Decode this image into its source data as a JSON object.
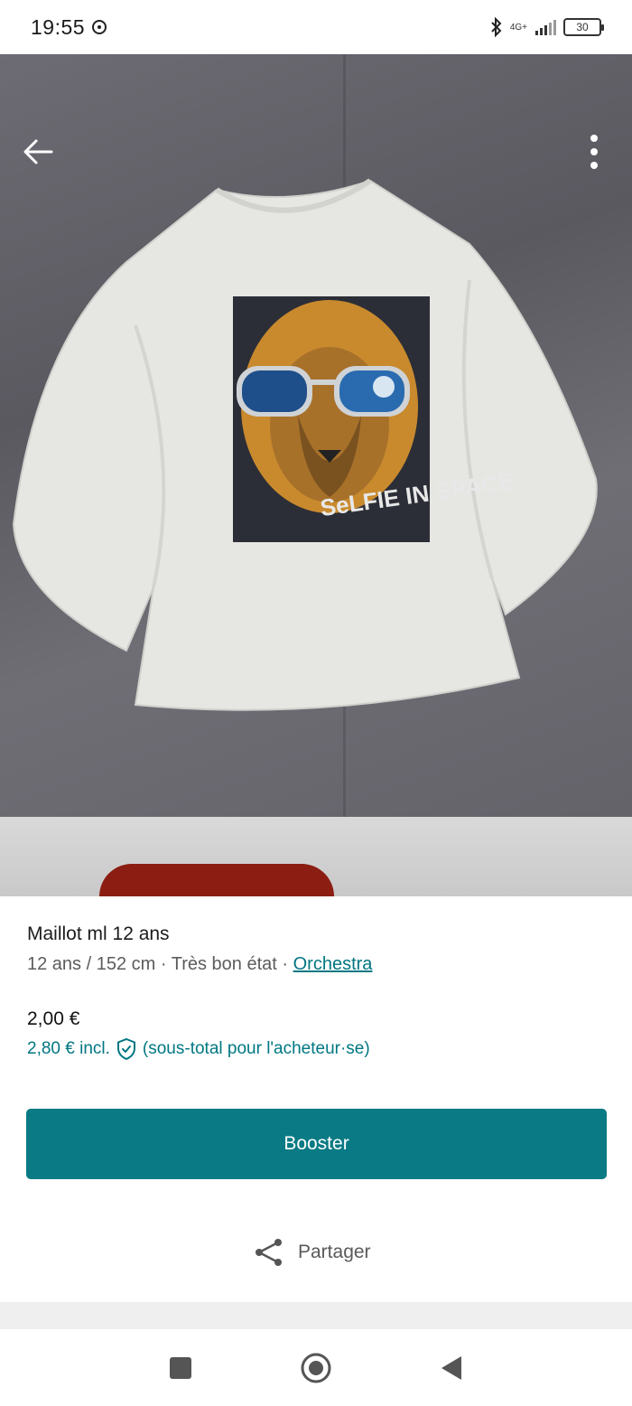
{
  "status_bar": {
    "time": "19:55",
    "network": "4G+",
    "battery": "30"
  },
  "photo": {
    "print_text": "SeLFIE IN SPACE"
  },
  "product": {
    "title": "Maillot ml 12 ans",
    "size": "12 ans / 152 cm",
    "separator": " · ",
    "condition": "Très bon état",
    "brand": "Orchestra",
    "price": "2,00 €",
    "price_incl": "2,80 € incl.",
    "price_incl_note": "(sous-total pour l'acheteur·se)"
  },
  "actions": {
    "booster_label": "Booster",
    "share_label": "Partager"
  },
  "icons": {
    "back": "arrow-left-icon",
    "more": "more-vertical-icon",
    "shield": "shield-check-icon",
    "share": "share-icon",
    "nav_recent": "square-icon",
    "nav_home": "circle-icon",
    "nav_back": "triangle-back-icon"
  },
  "colors": {
    "accent": "#007782",
    "button": "#0a7a84"
  }
}
